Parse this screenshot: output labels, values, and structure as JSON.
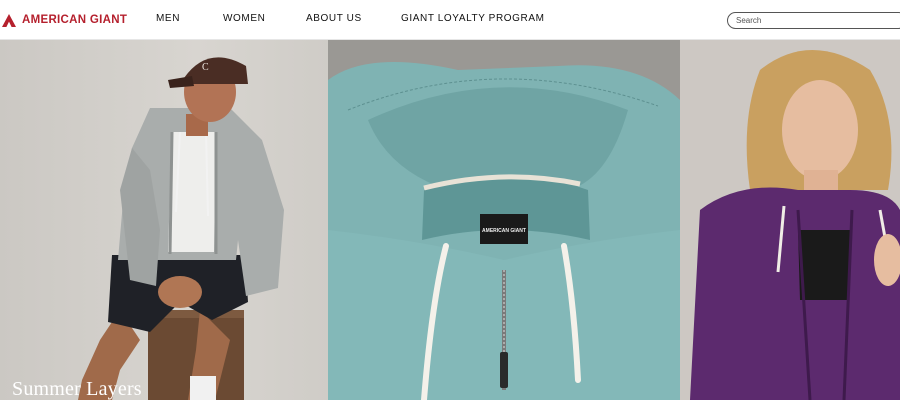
{
  "brand": {
    "name": "AMERICAN GIANT",
    "logo_icon": "ag-triangle-logo",
    "color": "#b5202d"
  },
  "nav": {
    "items": [
      {
        "label": "MEN"
      },
      {
        "label": "WOMEN"
      },
      {
        "label": "ABOUT US"
      },
      {
        "label": "GIANT LOYALTY PROGRAM"
      }
    ]
  },
  "search": {
    "placeholder": "Search",
    "value": ""
  },
  "hero": {
    "headline": "Summer Layers",
    "panels": [
      {
        "subject": "man-in-grey-hoodie"
      },
      {
        "subject": "teal-hoodie-closeup",
        "tag_text": "AMERICAN GIANT"
      },
      {
        "subject": "woman-in-purple-hoodie"
      }
    ]
  },
  "colors": {
    "text": "#111111",
    "teal": "#7fb3b3",
    "purple": "#5c2a6e"
  }
}
